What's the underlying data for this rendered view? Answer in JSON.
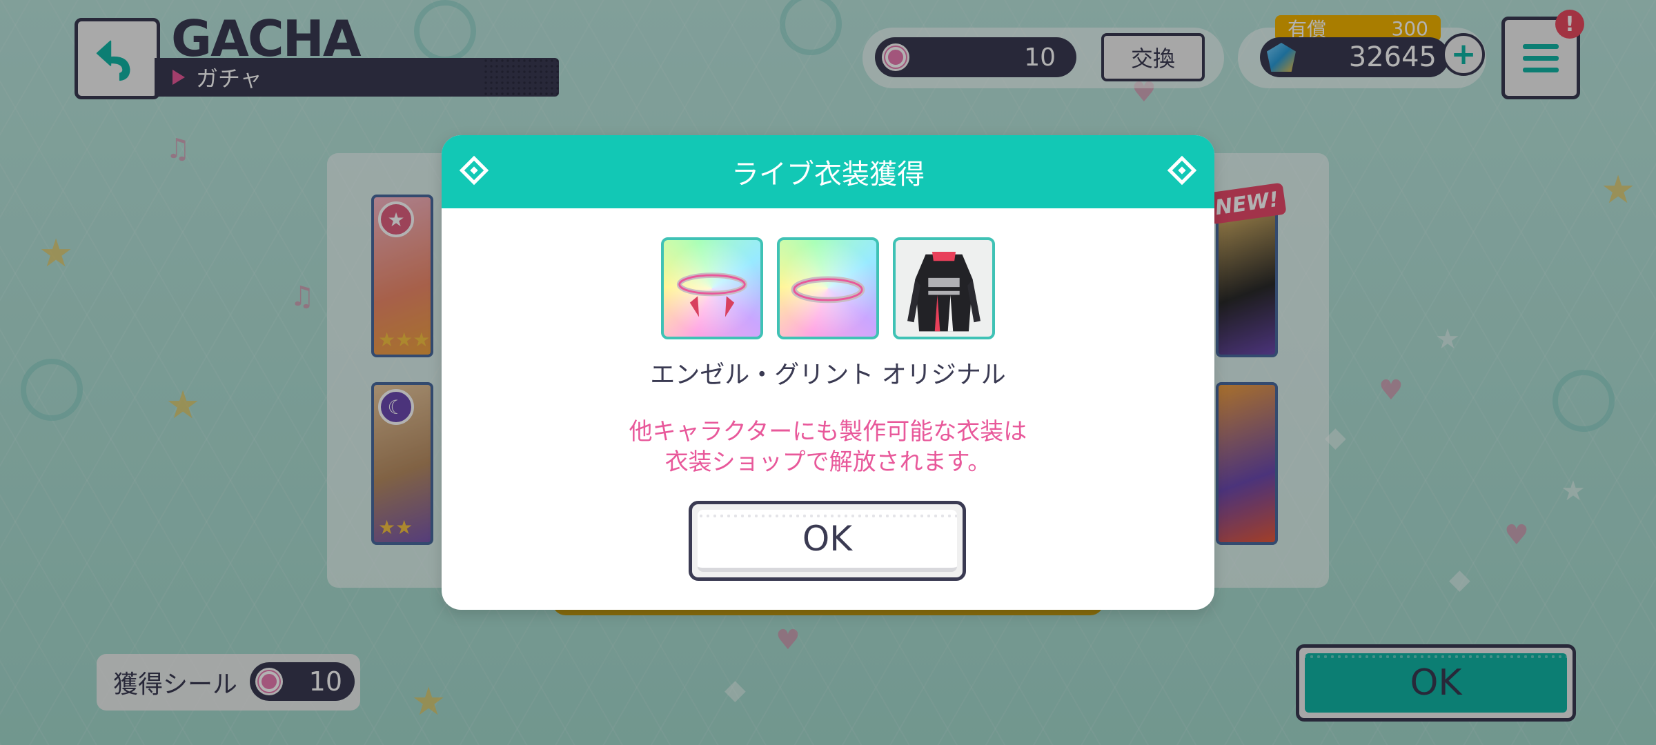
{
  "header": {
    "title": "GACHA",
    "subtitle": "ガチャ"
  },
  "currency": {
    "seals": "10",
    "exchange_label": "交換",
    "paid_label": "有償",
    "paid_value": "300",
    "gems": "32645",
    "plus_label": "+",
    "alert": "!"
  },
  "results": {
    "new_tag": "NEW!"
  },
  "dialog": {
    "title": "ライブ衣装獲得",
    "item_name": "エンゼル・グリント オリジナル",
    "notice_line1": "他キャラクターにも製作可能な衣装は",
    "notice_line2": "衣装ショップで解放されます。",
    "ok_label": "OK"
  },
  "footer": {
    "seal_acquired_label": "獲得シール",
    "seal_acquired_count": "10",
    "ok_label": "OK"
  },
  "colors": {
    "accent": "#12c8b5",
    "dark": "#3a3a52",
    "notice": "#e8589a",
    "paid": "#f2b400"
  },
  "icons": [
    "back-arrow-icon",
    "seal-icon",
    "gem-icon",
    "plus-icon",
    "menu-icon",
    "alert-icon",
    "diamond-icon"
  ]
}
